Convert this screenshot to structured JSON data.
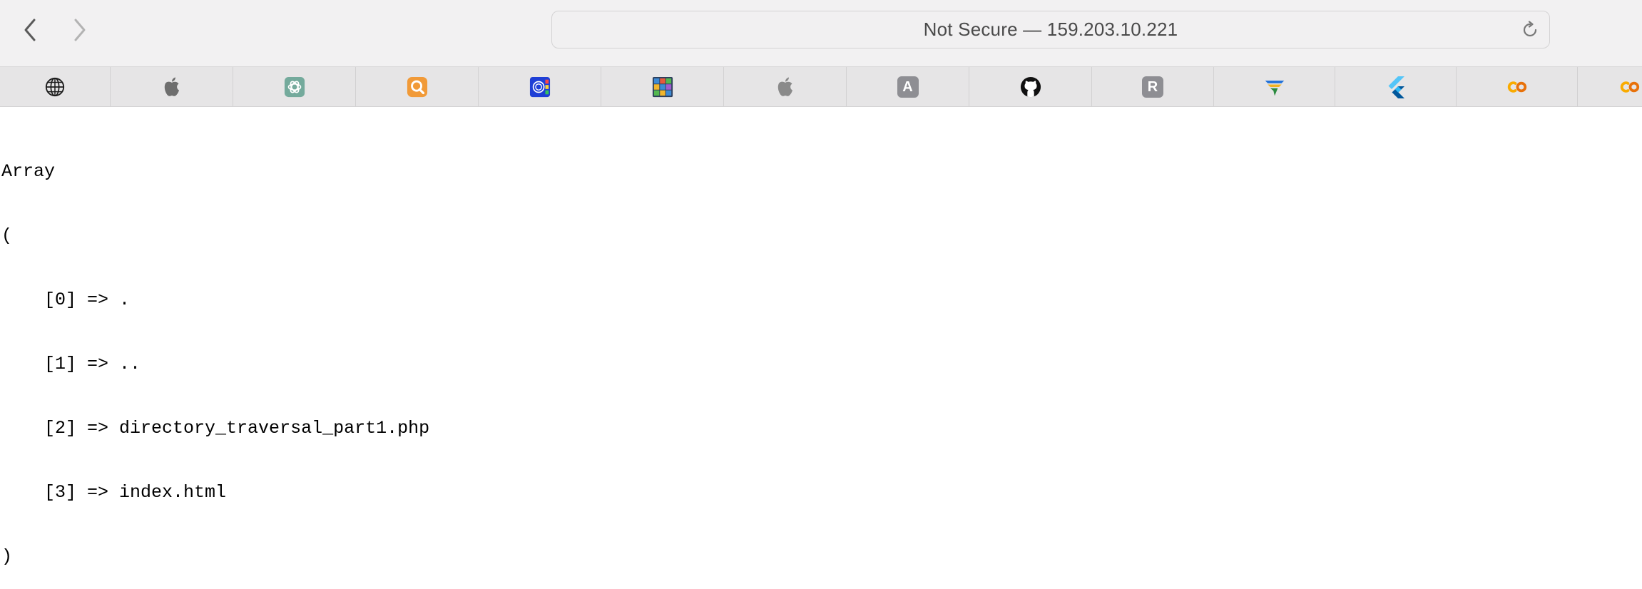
{
  "browser": {
    "address": "Not Secure — 159.203.10.221",
    "nav": {
      "back_icon": "chevron-left-icon",
      "forward_icon": "chevron-right-icon",
      "reload_icon": "reload-icon"
    }
  },
  "favorites": [
    {
      "name": "globe",
      "icon": "globe-icon",
      "label": ""
    },
    {
      "name": "apple",
      "icon": "apple-icon",
      "label": ""
    },
    {
      "name": "chatgpt",
      "icon": "openai-icon",
      "label": ""
    },
    {
      "name": "qreader",
      "icon": "q-search-icon",
      "label": ""
    },
    {
      "name": "seal-app",
      "icon": "blue-app-icon",
      "label": ""
    },
    {
      "name": "grid-app",
      "icon": "grid-icon",
      "label": ""
    },
    {
      "name": "apple-2",
      "icon": "apple-icon",
      "label": ""
    },
    {
      "name": "a-site",
      "icon": "letter-a-icon",
      "label": "A"
    },
    {
      "name": "github",
      "icon": "github-icon",
      "label": ""
    },
    {
      "name": "r-site",
      "icon": "letter-r-icon",
      "label": "R"
    },
    {
      "name": "winged-app",
      "icon": "wing-icon",
      "label": ""
    },
    {
      "name": "flutter",
      "icon": "flutter-icon",
      "label": ""
    },
    {
      "name": "colab",
      "icon": "colab-icon",
      "label": ""
    },
    {
      "name": "colab-2",
      "icon": "colab-icon",
      "label": ""
    }
  ],
  "colors": {
    "toolbar_bg": "#f2f1f2",
    "favbar_bg": "#e6e5e6",
    "address_text": "#4a4a4a",
    "page_bg": "#ffffff"
  },
  "content": {
    "lines": [
      "Array",
      "(",
      "    [0] => .",
      "    [1] => ..",
      "    [2] => directory_traversal_part1.php",
      "    [3] => index.html",
      ")"
    ]
  }
}
